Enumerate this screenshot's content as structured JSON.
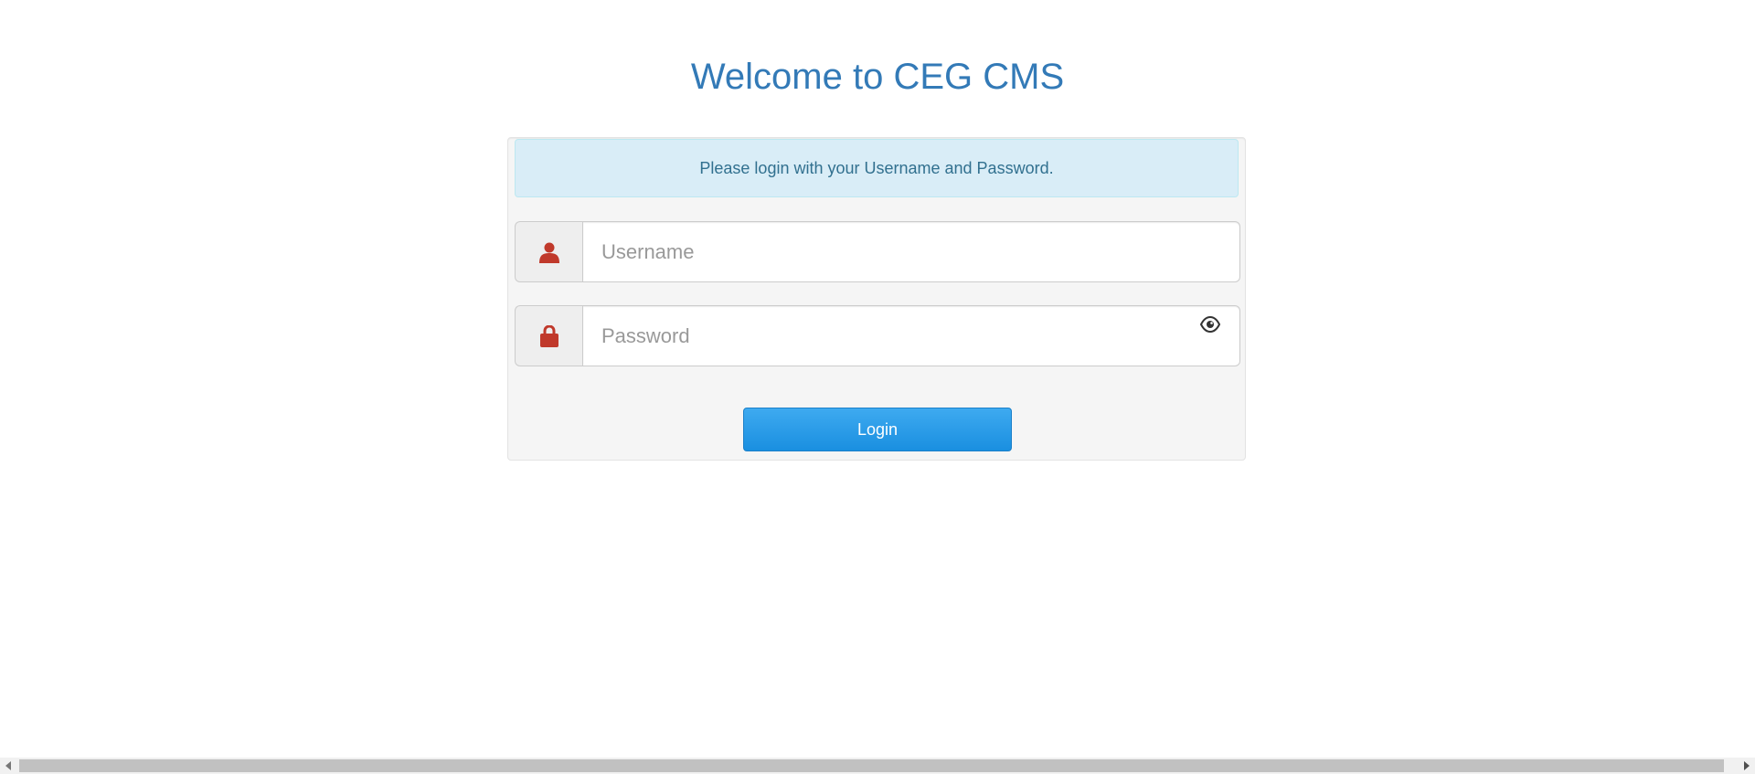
{
  "page": {
    "title": "Welcome to CEG CMS"
  },
  "login_panel": {
    "info_message": "Please login with your Username and Password.",
    "username": {
      "placeholder": "Username",
      "value": "",
      "icon": "user-icon"
    },
    "password": {
      "placeholder": "Password",
      "value": "",
      "icon": "lock-icon",
      "toggle_icon": "eye-icon"
    },
    "login_label": "Login"
  },
  "colors": {
    "title": "#337ab7",
    "alert_bg": "#d9edf7",
    "alert_text": "#31708f",
    "icon_red": "#c0392b",
    "button": "#1a8fe0"
  }
}
